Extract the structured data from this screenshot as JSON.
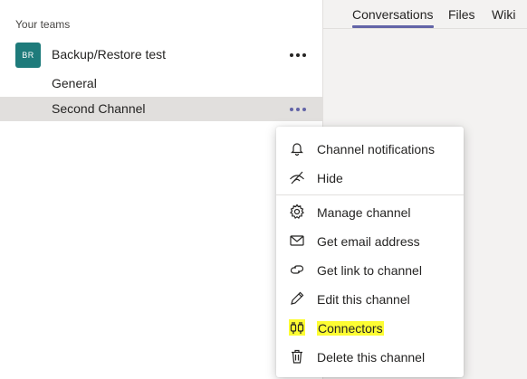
{
  "sidebar": {
    "heading": "Your teams",
    "team": {
      "name": "Backup/Restore test",
      "avatar_initials": "BR",
      "avatar_color": "#1e7b7b"
    },
    "channels": [
      {
        "label": "General"
      },
      {
        "label": "Second Channel",
        "selected": true
      }
    ]
  },
  "tabs": [
    {
      "label": "Conversations",
      "active": true
    },
    {
      "label": "Files"
    },
    {
      "label": "Wiki"
    }
  ],
  "context_menu": {
    "items": [
      {
        "label": "Channel notifications",
        "icon": "bell-icon"
      },
      {
        "label": "Hide",
        "icon": "hide-icon"
      },
      {
        "label": "Manage channel",
        "icon": "gear-icon"
      },
      {
        "label": "Get email address",
        "icon": "mail-icon"
      },
      {
        "label": "Get link to channel",
        "icon": "link-icon"
      },
      {
        "label": "Edit this channel",
        "icon": "pencil-icon"
      },
      {
        "label": "Connectors",
        "icon": "connector-icon",
        "highlighted": true,
        "highlight_color": "#fdfd33"
      },
      {
        "label": "Delete this channel",
        "icon": "trash-icon"
      }
    ]
  },
  "colors": {
    "accent": "#6264a7",
    "selected_row": "#e1dfdd"
  }
}
